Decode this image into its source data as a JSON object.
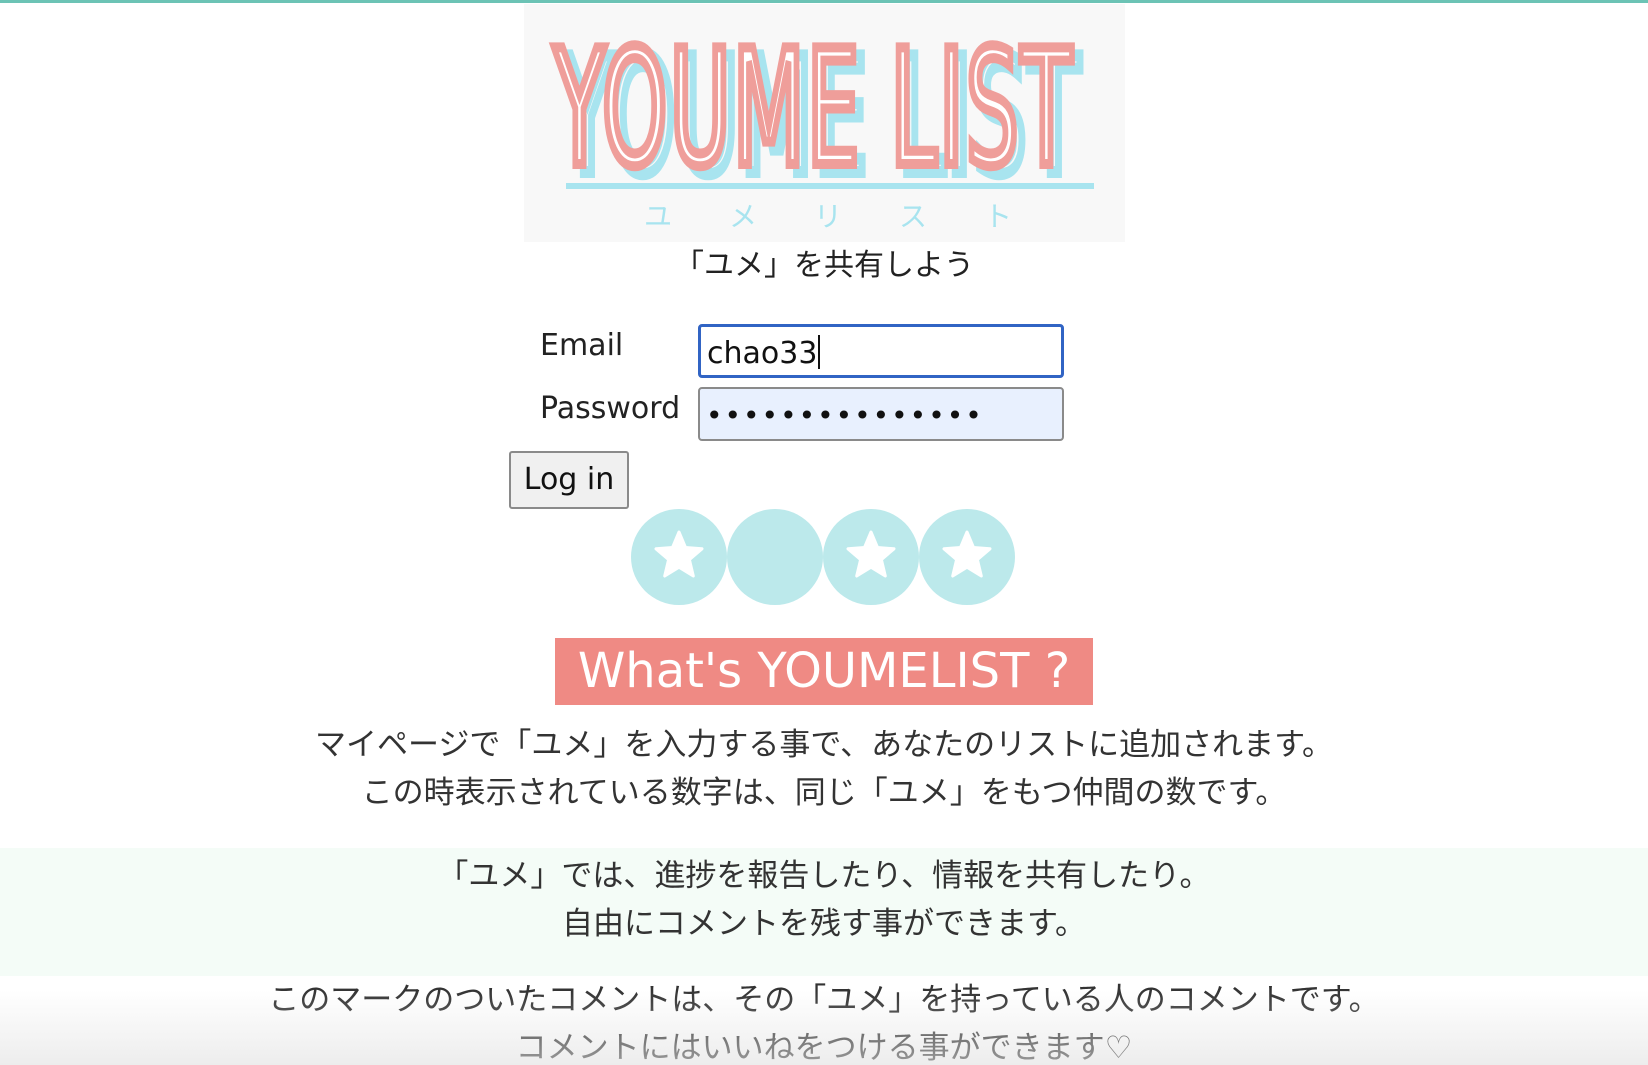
{
  "logo": {
    "title": "YOUME LIST",
    "kana": [
      "ユ",
      "メ",
      "リ",
      "ス",
      "ト"
    ],
    "colors": {
      "primary": "#ef9e9a",
      "shadow": "#a8e4ef",
      "background": "#f8f8f8"
    }
  },
  "tagline": "「ユメ」を共有しよう",
  "form": {
    "email_label": "Email",
    "email_value": "chao33",
    "password_label": "Password",
    "password_value": "•••••••••••••••",
    "login_label": "Log in"
  },
  "stars": [
    {
      "icon": "star-icon",
      "filled": true
    },
    {
      "icon": "none",
      "filled": false
    },
    {
      "icon": "star-icon",
      "filled": true
    },
    {
      "icon": "star-icon",
      "filled": true
    }
  ],
  "about": {
    "heading": "What's YOUMELIST ?",
    "para1": [
      "マイページで「ユメ」を入力する事で、あなたのリストに追加されます。",
      "この時表示されている数字は、同じ「ユメ」をもつ仲間の数です。"
    ],
    "para2": [
      "「ユメ」では、進捗を報告したり、情報を共有したり。",
      "自由にコメントを残す事ができます。"
    ],
    "para3": [
      "このマークのついたコメントは、その「ユメ」を持っている人のコメントです。",
      "コメントにはいいねをつける事ができます♡"
    ]
  },
  "colors": {
    "accent": "#6cc3b5",
    "heading_bg": "#ef8a84",
    "star_circle": "#bce9eb",
    "input_focus": "#3164c4",
    "autofill_bg": "#e8f0fe",
    "section_bg": "#f4fcf7"
  }
}
